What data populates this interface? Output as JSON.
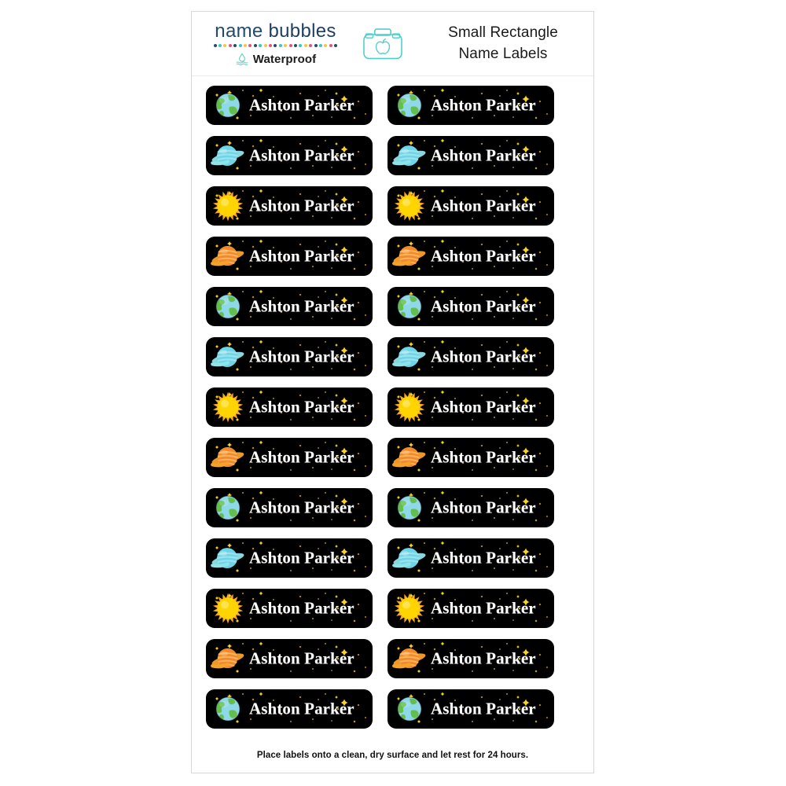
{
  "page": {
    "background": "#ffffff",
    "sheet_border_color": "#d8d8d8"
  },
  "header": {
    "brand": {
      "word_one": "name",
      "word_two": "bubbles",
      "wordmark_color": "#214a6e",
      "dot_colors": [
        "#2b4a6f",
        "#3fc4c4",
        "#f5c542",
        "#e2547a",
        "#2b4a6f",
        "#3fc4c4",
        "#f5c542",
        "#e2547a",
        "#2b4a6f",
        "#3fc4c4",
        "#f5c542",
        "#e2547a",
        "#2b4a6f",
        "#3fc4c4",
        "#f5c542",
        "#e2547a",
        "#2b4a6f",
        "#3fc4c4",
        "#f5c542",
        "#e2547a",
        "#2b4a6f",
        "#3fc4c4",
        "#f5c542",
        "#e2547a",
        "#2b4a6f"
      ],
      "waterproof_label": "Waterproof",
      "waterproof_icon": "water-droplet-icon",
      "waterproof_icon_color": "#4dc8c0"
    },
    "product_icon": {
      "name": "lunchbox-apple-icon",
      "color": "#4ecfc9"
    },
    "title_line_1": "Small Rectangle",
    "title_line_2": "Name Labels"
  },
  "labels": {
    "name_text": "Ashton Parker",
    "background": "#000000",
    "text_color": "#ffffff",
    "star_color": "#ffd324",
    "rows": 13,
    "columns": 2,
    "total": 26,
    "items": [
      {
        "index": 1,
        "column": "left",
        "icon": "earth-planet-icon",
        "name": "Ashton Parker"
      },
      {
        "index": 2,
        "column": "right",
        "icon": "earth-planet-icon",
        "name": "Ashton Parker"
      },
      {
        "index": 3,
        "column": "left",
        "icon": "blue-ringed-planet-icon",
        "name": "Ashton Parker"
      },
      {
        "index": 4,
        "column": "right",
        "icon": "blue-ringed-planet-icon",
        "name": "Ashton Parker"
      },
      {
        "index": 5,
        "column": "left",
        "icon": "sun-icon",
        "name": "Ashton Parker"
      },
      {
        "index": 6,
        "column": "right",
        "icon": "sun-icon",
        "name": "Ashton Parker"
      },
      {
        "index": 7,
        "column": "left",
        "icon": "saturn-planet-icon",
        "name": "Ashton Parker"
      },
      {
        "index": 8,
        "column": "right",
        "icon": "saturn-planet-icon",
        "name": "Ashton Parker"
      },
      {
        "index": 9,
        "column": "left",
        "icon": "earth-planet-icon",
        "name": "Ashton Parker"
      },
      {
        "index": 10,
        "column": "right",
        "icon": "earth-planet-icon",
        "name": "Ashton Parker"
      },
      {
        "index": 11,
        "column": "left",
        "icon": "blue-ringed-planet-icon",
        "name": "Ashton Parker"
      },
      {
        "index": 12,
        "column": "right",
        "icon": "blue-ringed-planet-icon",
        "name": "Ashton Parker"
      },
      {
        "index": 13,
        "column": "left",
        "icon": "sun-icon",
        "name": "Ashton Parker"
      },
      {
        "index": 14,
        "column": "right",
        "icon": "sun-icon",
        "name": "Ashton Parker"
      },
      {
        "index": 15,
        "column": "left",
        "icon": "saturn-planet-icon",
        "name": "Ashton Parker"
      },
      {
        "index": 16,
        "column": "right",
        "icon": "saturn-planet-icon",
        "name": "Ashton Parker"
      },
      {
        "index": 17,
        "column": "left",
        "icon": "earth-planet-icon",
        "name": "Ashton Parker"
      },
      {
        "index": 18,
        "column": "right",
        "icon": "earth-planet-icon",
        "name": "Ashton Parker"
      },
      {
        "index": 19,
        "column": "left",
        "icon": "blue-ringed-planet-icon",
        "name": "Ashton Parker"
      },
      {
        "index": 20,
        "column": "right",
        "icon": "blue-ringed-planet-icon",
        "name": "Ashton Parker"
      },
      {
        "index": 21,
        "column": "left",
        "icon": "sun-icon",
        "name": "Ashton Parker"
      },
      {
        "index": 22,
        "column": "right",
        "icon": "sun-icon",
        "name": "Ashton Parker"
      },
      {
        "index": 23,
        "column": "left",
        "icon": "saturn-planet-icon",
        "name": "Ashton Parker"
      },
      {
        "index": 24,
        "column": "right",
        "icon": "saturn-planet-icon",
        "name": "Ashton Parker"
      },
      {
        "index": 25,
        "column": "left",
        "icon": "earth-planet-icon",
        "name": "Ashton Parker"
      },
      {
        "index": 26,
        "column": "right",
        "icon": "earth-planet-icon",
        "name": "Ashton Parker"
      }
    ]
  },
  "footer": {
    "instruction": "Place labels onto a clean, dry surface and let rest for 24 hours."
  }
}
